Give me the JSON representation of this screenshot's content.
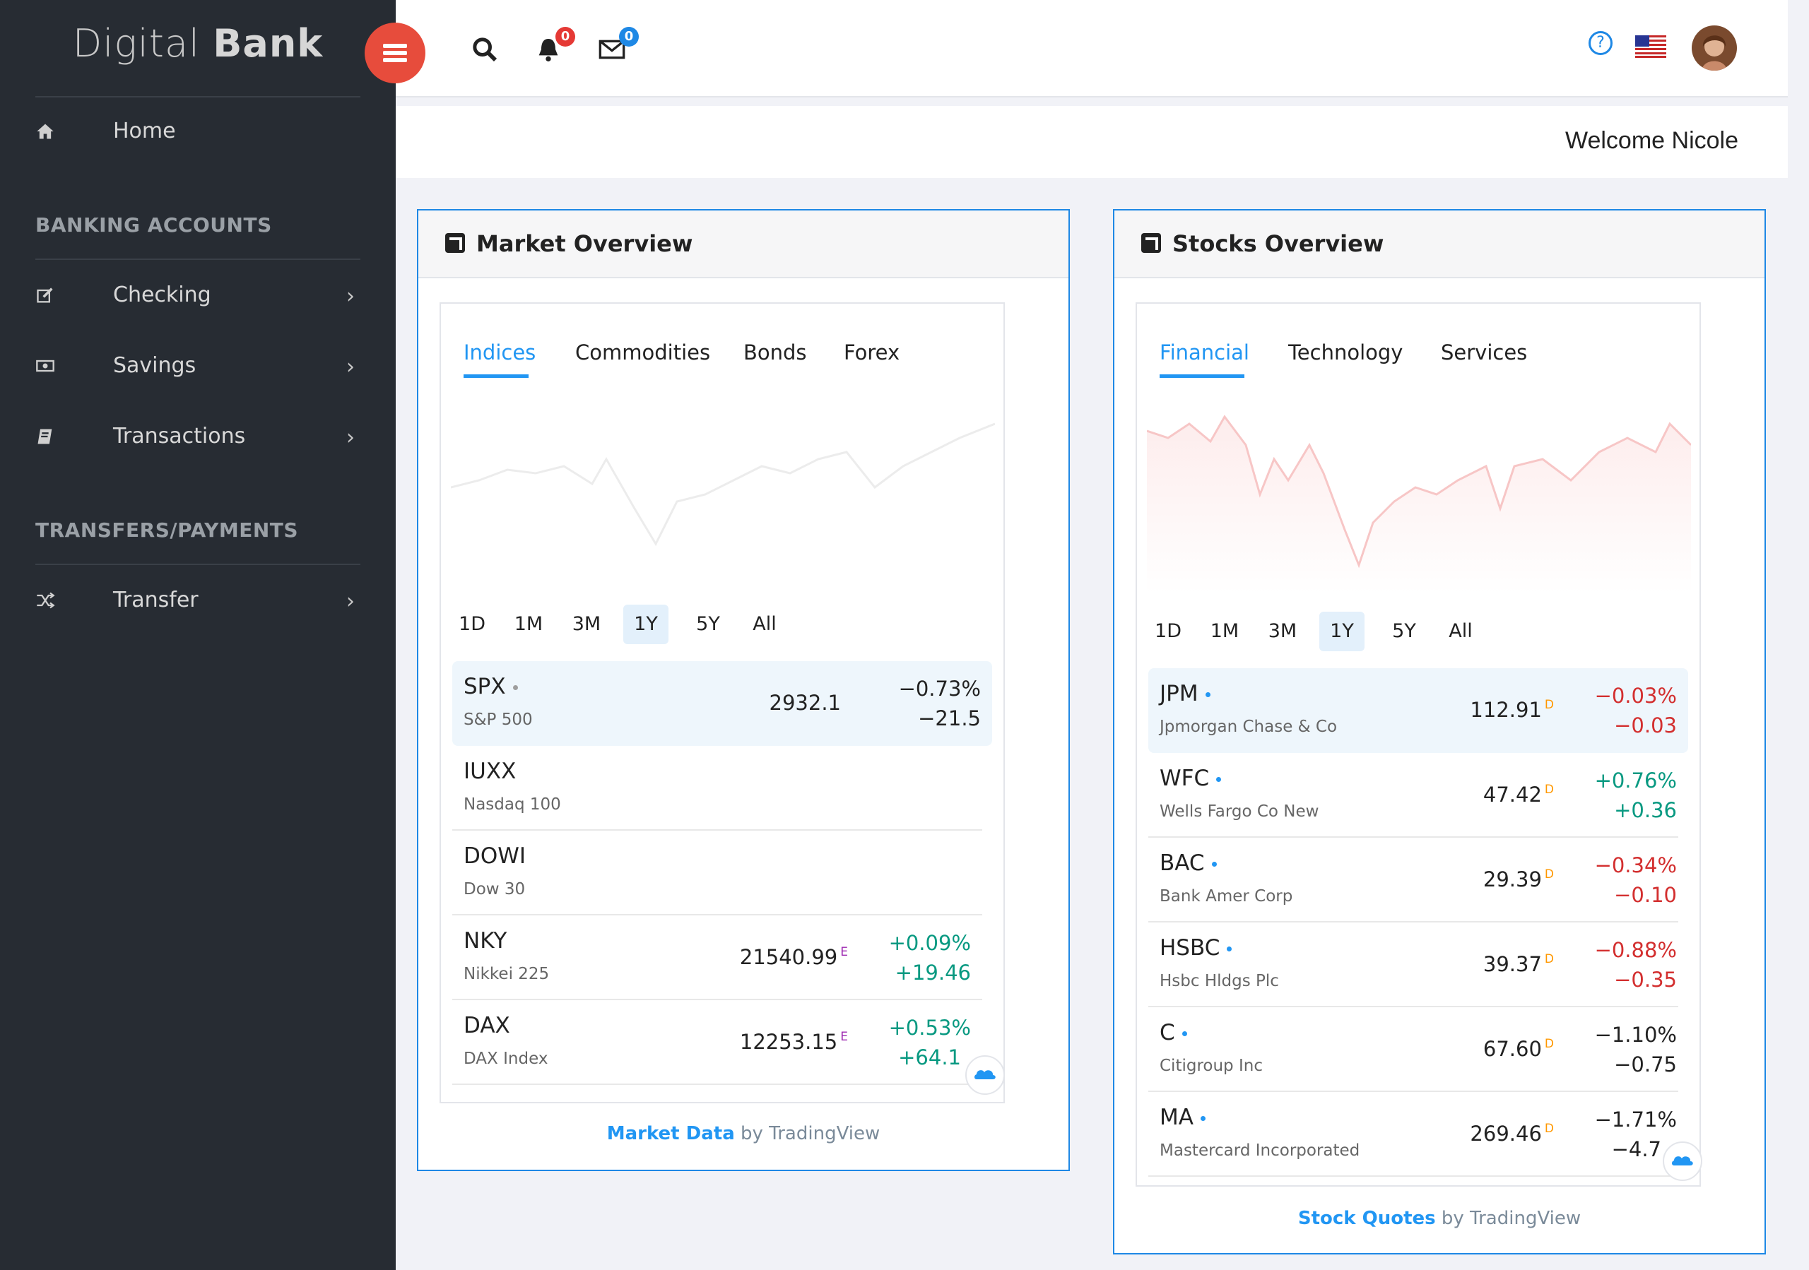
{
  "brand": {
    "light": "Digital ",
    "bold": "Bank"
  },
  "sidebar": {
    "home": "Home",
    "section_banking": "BANKING ACCOUNTS",
    "checking": "Checking",
    "savings": "Savings",
    "transactions": "Transactions",
    "section_transfers": "TRANSFERS/PAYMENTS",
    "transfer": "Transfer"
  },
  "topbar": {
    "notifications_count": "0",
    "messages_count": "0",
    "help": "?"
  },
  "welcome": "Welcome Nicole",
  "market": {
    "title": "Market Overview",
    "tabs": [
      "Indices",
      "Commodities",
      "Bonds",
      "Forex"
    ],
    "ranges": [
      "1D",
      "1M",
      "3M",
      "1Y",
      "5Y",
      "All"
    ],
    "rows": [
      {
        "sym": "SPX",
        "desc": "S&P 500",
        "price": "2932.1",
        "sup": "",
        "chg_pct": "−0.73%",
        "chg": "−21.5"
      },
      {
        "sym": "IUXX",
        "desc": "Nasdaq 100",
        "price": "",
        "sup": "",
        "chg_pct": "",
        "chg": ""
      },
      {
        "sym": "DOWI",
        "desc": "Dow 30",
        "price": "",
        "sup": "",
        "chg_pct": "",
        "chg": ""
      },
      {
        "sym": "NKY",
        "desc": "Nikkei 225",
        "price": "21540.99",
        "sup": "E",
        "chg_pct": "+0.09%",
        "chg": "+19.46"
      },
      {
        "sym": "DAX",
        "desc": "DAX Index",
        "price": "12253.15",
        "sup": "E",
        "chg_pct": "+0.53%",
        "chg": "+64.1"
      }
    ],
    "footer_a": "Market Data",
    "footer_b": " by TradingView"
  },
  "stocks": {
    "title": "Stocks Overview",
    "tabs": [
      "Financial",
      "Technology",
      "Services"
    ],
    "ranges": [
      "1D",
      "1M",
      "3M",
      "1Y",
      "5Y",
      "All"
    ],
    "rows": [
      {
        "sym": "JPM",
        "desc": "Jpmorgan Chase & Co",
        "price": "112.91",
        "sup": "D",
        "chg_pct": "−0.03%",
        "chg": "−0.03"
      },
      {
        "sym": "WFC",
        "desc": "Wells Fargo Co New",
        "price": "47.42",
        "sup": "D",
        "chg_pct": "+0.76%",
        "chg": "+0.36"
      },
      {
        "sym": "BAC",
        "desc": "Bank Amer Corp",
        "price": "29.39",
        "sup": "D",
        "chg_pct": "−0.34%",
        "chg": "−0.10"
      },
      {
        "sym": "HSBC",
        "desc": "Hsbc Hldgs Plc",
        "price": "39.37",
        "sup": "D",
        "chg_pct": "−0.88%",
        "chg": "−0.35"
      },
      {
        "sym": "C",
        "desc": "Citigroup Inc",
        "price": "67.60",
        "sup": "D",
        "chg_pct": "−1.10%",
        "chg": "−0.75"
      },
      {
        "sym": "MA",
        "desc": "Mastercard Incorporated",
        "price": "269.46",
        "sup": "D",
        "chg_pct": "−1.71%",
        "chg": "−4.7"
      }
    ],
    "footer_a": "Stock Quotes",
    "footer_b": " by TradingView"
  },
  "colors": {
    "accent": "#2196f3",
    "positive": "#089981",
    "negative": "#d32f2f",
    "sidebar": "#272c33",
    "menu_button": "#e74c3c"
  }
}
